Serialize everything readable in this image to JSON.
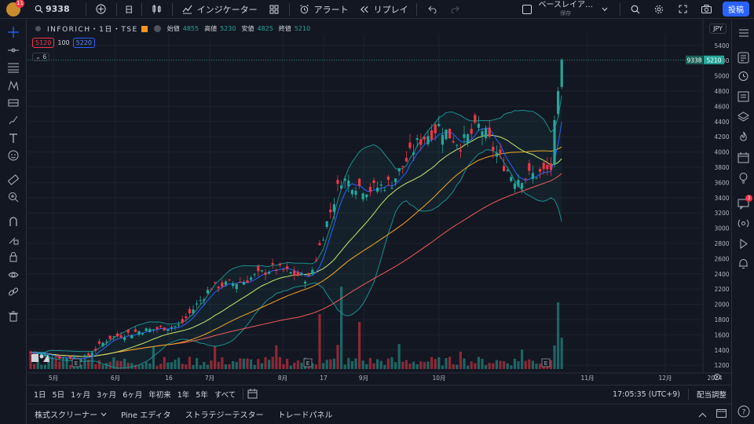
{
  "topbar": {
    "avatar_badge": "11",
    "symbol": "9338",
    "interval": "日",
    "indicators_label": "インジケーター",
    "alert_label": "アラート",
    "replay_label": "リプレイ",
    "layout_name": "ベースレイア…",
    "layout_status": "保存",
    "publish_label": "投稿"
  },
  "legend": {
    "symbol_name": "INFORICH・1日・TSE",
    "open_label": "始値",
    "open_value": "4855",
    "high_label": "高値",
    "high_value": "5230",
    "low_label": "安値",
    "low_value": "4825",
    "close_label": "終値",
    "close_value": "5210",
    "bid": "5120",
    "spread": "100",
    "ask": "5220",
    "indicator_count": "6",
    "currency": "JPY"
  },
  "price_tag": {
    "symbol": "9338",
    "price": "5210"
  },
  "colors": {
    "up": "#26a69a",
    "down": "#f23645",
    "bb": "#1d8f8f",
    "ma_fast": "#2962ff",
    "ma_mid": "#c8e66e",
    "ma_slow": "#f5a623",
    "ma_long": "#f05a5a",
    "bg": "#131722"
  },
  "chart_data": {
    "type": "candlestick",
    "y_ticks": [
      "5400",
      "5200",
      "5000",
      "4800",
      "4600",
      "4400",
      "4200",
      "4000",
      "3800",
      "3600",
      "3400",
      "3200",
      "3000",
      "2800",
      "2600",
      "2400",
      "2200",
      "2000",
      "1800",
      "1600",
      "1400",
      "1200"
    ],
    "ylim": [
      1150,
      5450
    ],
    "x_ticks": [
      "5月",
      "6月",
      "16",
      "7月",
      "8月",
      "17",
      "9月",
      "10月",
      "11月",
      "12月",
      "2024"
    ],
    "last_price": 5210
  },
  "ranges": [
    "1日",
    "5日",
    "1ヶ月",
    "3ヶ月",
    "6ヶ月",
    "年初来",
    "1年",
    "5年",
    "すべて"
  ],
  "clock": "17:05:35 (UTC+9)",
  "adjust_label": "配当調整",
  "panels": [
    "株式スクリーナー",
    "Pine エディタ",
    "ストラテジーテスター",
    "トレードパネル"
  ],
  "right_badge": "3"
}
